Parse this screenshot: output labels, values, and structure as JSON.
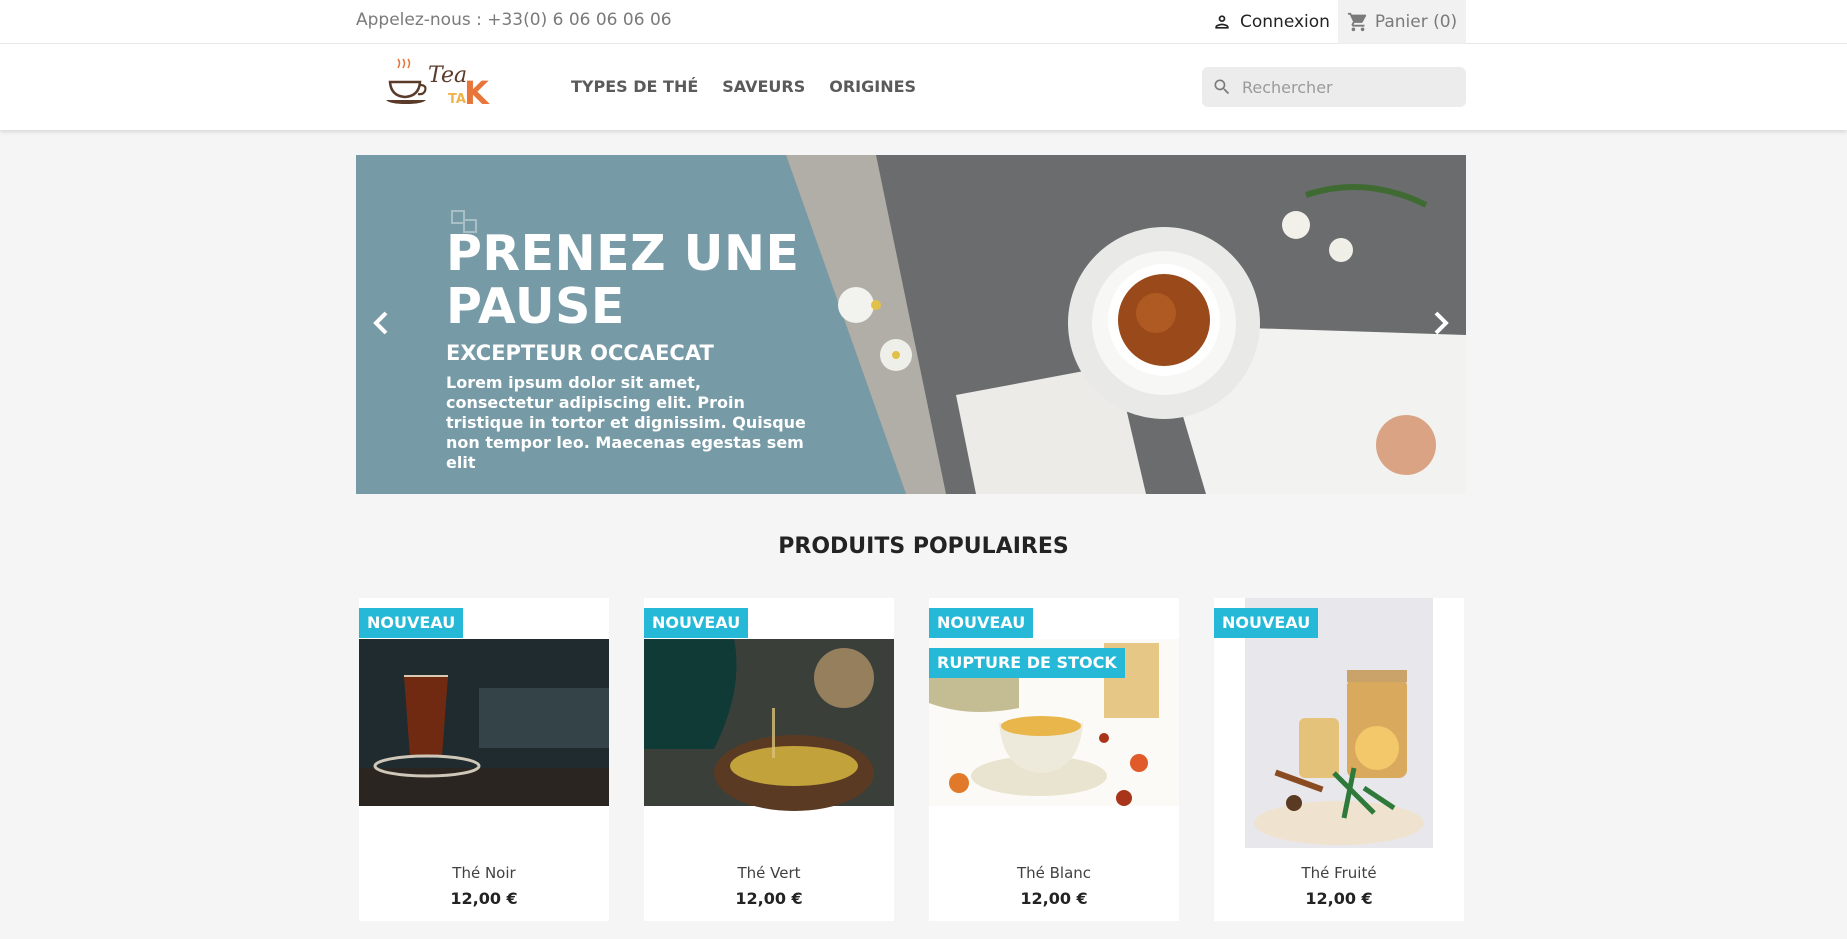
{
  "topbar": {
    "call_text": "Appelez-nous : +33(0) 6 06 06 06 06",
    "login_label": "Connexion",
    "cart_label": "Panier (0)"
  },
  "header": {
    "logo_text_1": "Tea",
    "logo_text_2": "TA",
    "logo_text_3": "K",
    "menu": [
      {
        "label": "TYPES DE THÉ"
      },
      {
        "label": "SAVEURS"
      },
      {
        "label": "ORIGINES"
      }
    ],
    "search": {
      "placeholder": "Rechercher"
    }
  },
  "slider": {
    "title": "PRENEZ UNE PAUSE",
    "subtitle": "EXCEPTEUR OCCAECAT",
    "description": "Lorem ipsum dolor sit amet, consectetur adipiscing elit. Proin tristique in tortor et dignissim. Quisque non tempor leo. Maecenas egestas sem elit",
    "prev_icon": "chevron-left-icon",
    "next_icon": "chevron-right-icon"
  },
  "popular": {
    "title": "PRODUITS POPULAIRES",
    "products": [
      {
        "name": "Thé Noir",
        "price": "12,00 €",
        "badges": [
          "NOUVEAU"
        ]
      },
      {
        "name": "Thé Vert",
        "price": "12,00 €",
        "badges": [
          "NOUVEAU"
        ]
      },
      {
        "name": "Thé Blanc",
        "price": "12,00 €",
        "badges": [
          "NOUVEAU",
          "RUPTURE DE STOCK"
        ]
      },
      {
        "name": "Thé Fruité",
        "price": "12,00 €",
        "badges": [
          "NOUVEAU"
        ]
      }
    ]
  },
  "colors": {
    "accent": "#25b9d7",
    "slide_bg": "#769aa6",
    "logo_orange": "#e8763a"
  }
}
